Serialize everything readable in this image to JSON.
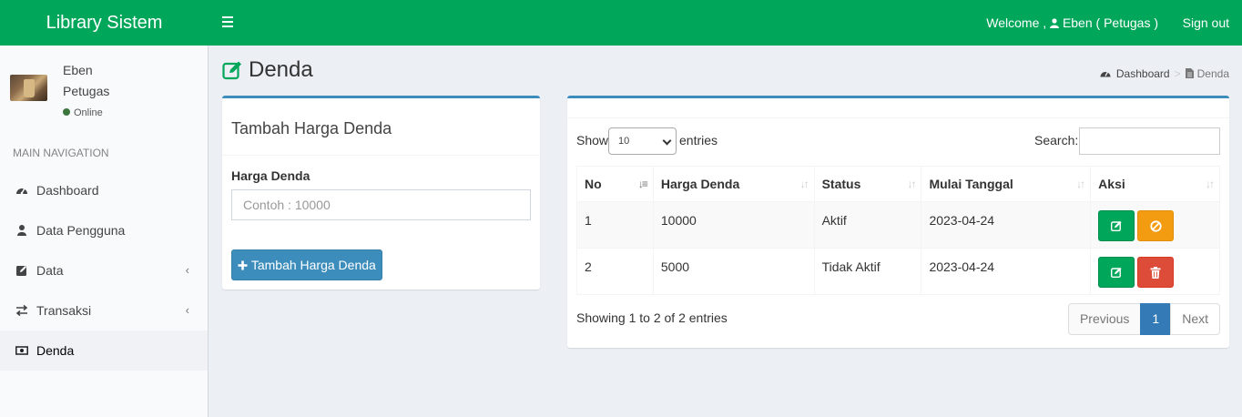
{
  "header": {
    "logo": "Library Sistem",
    "welcome": "Welcome ,",
    "user": "Eben ( Petugas )",
    "signout": "Sign out"
  },
  "sidebar": {
    "user": {
      "name": "Eben",
      "role": "Petugas",
      "status": "Online"
    },
    "nav_header": "MAIN NAVIGATION",
    "items": [
      {
        "label": "Dashboard",
        "icon": "dashboard-icon"
      },
      {
        "label": "Data Pengguna",
        "icon": "user-icon"
      },
      {
        "label": "Data",
        "icon": "edit-icon",
        "chevron": "‹"
      },
      {
        "label": "Transaksi",
        "icon": "exchange-icon",
        "chevron": "‹"
      },
      {
        "label": "Denda",
        "icon": "money-icon",
        "active": true
      }
    ]
  },
  "page": {
    "title": "Denda",
    "breadcrumb": {
      "home": "Dashboard",
      "separator": ">",
      "current": "Denda"
    }
  },
  "form": {
    "title": "Tambah Harga Denda",
    "field_label": "Harga Denda",
    "placeholder": "Contoh : 10000",
    "submit": "Tambah Harga Denda"
  },
  "table": {
    "show": "Show",
    "length": "10",
    "entries": "entries",
    "search": "Search:",
    "columns": [
      "No",
      "Harga Denda",
      "Status",
      "Mulai Tanggal",
      "Aksi"
    ],
    "rows": [
      {
        "no": "1",
        "harga": "10000",
        "status": "Aktif",
        "tanggal": "2023-04-24"
      },
      {
        "no": "2",
        "harga": "5000",
        "status": "Tidak Aktif",
        "tanggal": "2023-04-24"
      }
    ],
    "info": "Showing 1 to 2 of 2 entries",
    "pagination": {
      "previous": "Previous",
      "page": "1",
      "next": "Next"
    }
  },
  "colors": {
    "header": "#00a65a",
    "primary": "#3c8dbc",
    "success": "#00a65a",
    "warning": "#f39c12",
    "danger": "#dd4b39"
  }
}
